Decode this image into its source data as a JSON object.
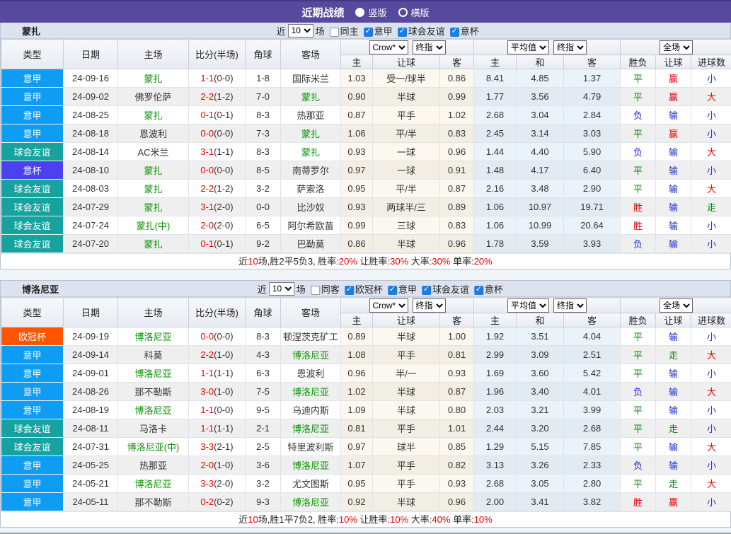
{
  "topbar": {
    "title": "近期战绩",
    "options": [
      {
        "label": "竖版",
        "selected": true
      },
      {
        "label": "横版",
        "selected": false
      }
    ]
  },
  "table_header": {
    "main_columns": [
      "类型",
      "日期",
      "主场",
      "比分(半场)",
      "角球",
      "客场"
    ],
    "group1": {
      "selects": [
        "Crow*",
        "终指"
      ],
      "subs": [
        "主",
        "让球",
        "客"
      ]
    },
    "group2": {
      "selects": [
        "平均值",
        "终指"
      ],
      "subs": [
        "主",
        "和",
        "客"
      ]
    },
    "group3": {
      "selects": [
        "全场"
      ],
      "subs": [
        "胜负",
        "让球",
        "进球数"
      ]
    }
  },
  "type_colors": {
    "意甲": "#0f9cf3",
    "球会友谊": "#16a29e",
    "意杯": "#4b42ee",
    "欧冠杯": "#ff5500"
  },
  "outcome_colors": {
    "red": "#e00000",
    "green": "#088108",
    "blue": "#2230ce"
  },
  "outcome_map": {
    "胜": "red",
    "赢": "red",
    "大": "red",
    "平": "green",
    "走": "green",
    "负": "blue",
    "输": "blue",
    "小": "blue"
  },
  "sections": [
    {
      "team": "蒙扎",
      "filter": {
        "near": "近",
        "count": "10",
        "games": "场",
        "same": "同主",
        "leagues": [
          "意甲",
          "球会友谊",
          "意杯"
        ]
      },
      "rows": [
        {
          "type": "意甲",
          "date": "24-09-16",
          "home": "蒙扎",
          "home_hl": true,
          "ft": "1-1",
          "ht": "(0-0)",
          "corner": "1-8",
          "away": "国际米兰",
          "away_hl": false,
          "crow_home": "1.03",
          "handicap": "受一/球半",
          "crow_away": "0.86",
          "avg_home": "8.41",
          "avg_draw": "4.85",
          "avg_away": "1.37",
          "result": "平",
          "hresult": "赢",
          "goals": "小"
        },
        {
          "type": "意甲",
          "date": "24-09-02",
          "home": "佛罗伦萨",
          "home_hl": false,
          "ft": "2-2",
          "ht": "(1-2)",
          "corner": "7-0",
          "away": "蒙扎",
          "away_hl": true,
          "crow_home": "0.90",
          "handicap": "半球",
          "crow_away": "0.99",
          "avg_home": "1.77",
          "avg_draw": "3.56",
          "avg_away": "4.79",
          "result": "平",
          "hresult": "赢",
          "goals": "大"
        },
        {
          "type": "意甲",
          "date": "24-08-25",
          "home": "蒙扎",
          "home_hl": true,
          "ft": "0-1",
          "ht": "(0-1)",
          "corner": "8-3",
          "away": "热那亚",
          "away_hl": false,
          "crow_home": "0.87",
          "handicap": "平手",
          "crow_away": "1.02",
          "avg_home": "2.68",
          "avg_draw": "3.04",
          "avg_away": "2.84",
          "result": "负",
          "hresult": "输",
          "goals": "小"
        },
        {
          "type": "意甲",
          "date": "24-08-18",
          "home": "恩波利",
          "home_hl": false,
          "ft": "0-0",
          "ht": "(0-0)",
          "corner": "7-3",
          "away": "蒙扎",
          "away_hl": true,
          "crow_home": "1.06",
          "handicap": "平/半",
          "crow_away": "0.83",
          "avg_home": "2.45",
          "avg_draw": "3.14",
          "avg_away": "3.03",
          "result": "平",
          "hresult": "赢",
          "goals": "小"
        },
        {
          "type": "球会友谊",
          "date": "24-08-14",
          "home": "AC米兰",
          "home_hl": false,
          "ft": "3-1",
          "ht": "(1-1)",
          "corner": "8-3",
          "away": "蒙扎",
          "away_hl": true,
          "crow_home": "0.93",
          "handicap": "一球",
          "crow_away": "0.96",
          "avg_home": "1.44",
          "avg_draw": "4.40",
          "avg_away": "5.90",
          "result": "负",
          "hresult": "输",
          "goals": "大"
        },
        {
          "type": "意杯",
          "date": "24-08-10",
          "home": "蒙扎",
          "home_hl": true,
          "ft": "0-0",
          "ht": "(0-0)",
          "corner": "8-5",
          "away": "南蒂罗尔",
          "away_hl": false,
          "crow_home": "0.97",
          "handicap": "一球",
          "crow_away": "0.91",
          "avg_home": "1.48",
          "avg_draw": "4.17",
          "avg_away": "6.40",
          "result": "平",
          "hresult": "输",
          "goals": "小"
        },
        {
          "type": "球会友谊",
          "date": "24-08-03",
          "home": "蒙扎",
          "home_hl": true,
          "ft": "2-2",
          "ht": "(1-2)",
          "corner": "3-2",
          "away": "萨索洛",
          "away_hl": false,
          "crow_home": "0.95",
          "handicap": "平/半",
          "crow_away": "0.87",
          "avg_home": "2.16",
          "avg_draw": "3.48",
          "avg_away": "2.90",
          "result": "平",
          "hresult": "输",
          "goals": "大"
        },
        {
          "type": "球会友谊",
          "date": "24-07-29",
          "home": "蒙扎",
          "home_hl": true,
          "ft": "3-1",
          "ht": "(2-0)",
          "corner": "0-0",
          "away": "比沙奴",
          "away_hl": false,
          "crow_home": "0.93",
          "handicap": "两球半/三",
          "crow_away": "0.89",
          "avg_home": "1.06",
          "avg_draw": "10.97",
          "avg_away": "19.71",
          "result": "胜",
          "hresult": "输",
          "goals": "走"
        },
        {
          "type": "球会友谊",
          "date": "24-07-24",
          "home": "蒙扎(中)",
          "home_hl": true,
          "ft": "2-0",
          "ht": "(2-0)",
          "corner": "6-5",
          "away": "阿尔希欧苗",
          "away_hl": false,
          "crow_home": "0.99",
          "handicap": "三球",
          "crow_away": "0.83",
          "avg_home": "1.06",
          "avg_draw": "10.99",
          "avg_away": "20.64",
          "result": "胜",
          "hresult": "输",
          "goals": "小"
        },
        {
          "type": "球会友谊",
          "date": "24-07-20",
          "home": "蒙扎",
          "home_hl": true,
          "ft": "0-1",
          "ht": "(0-1)",
          "corner": "9-2",
          "away": "巴勒莫",
          "away_hl": false,
          "crow_home": "0.86",
          "handicap": "半球",
          "crow_away": "0.96",
          "avg_home": "1.78",
          "avg_draw": "3.59",
          "avg_away": "3.93",
          "result": "负",
          "hresult": "输",
          "goals": "小"
        }
      ],
      "summary": [
        {
          "t": "近",
          "red": false
        },
        {
          "t": "10",
          "red": true
        },
        {
          "t": "场,胜2平5负3, 胜率:",
          "red": false
        },
        {
          "t": "20%",
          "red": true
        },
        {
          "t": " 让胜率:",
          "red": false
        },
        {
          "t": "30%",
          "red": true
        },
        {
          "t": " 大率:",
          "red": false
        },
        {
          "t": "30%",
          "red": true
        },
        {
          "t": " 单率:",
          "red": false
        },
        {
          "t": "20%",
          "red": true
        }
      ]
    },
    {
      "team": "博洛尼亚",
      "filter": {
        "near": "近",
        "count": "10",
        "games": "场",
        "same": "同客",
        "leagues": [
          "欧冠杯",
          "意甲",
          "球会友谊",
          "意杯"
        ]
      },
      "rows": [
        {
          "type": "欧冠杯",
          "date": "24-09-19",
          "home": "博洛尼亚",
          "home_hl": true,
          "ft": "0-0",
          "ht": "(0-0)",
          "corner": "8-3",
          "away": "顿涅茨克矿工",
          "away_hl": false,
          "crow_home": "0.89",
          "handicap": "半球",
          "crow_away": "1.00",
          "avg_home": "1.92",
          "avg_draw": "3.51",
          "avg_away": "4.04",
          "result": "平",
          "hresult": "输",
          "goals": "小"
        },
        {
          "type": "意甲",
          "date": "24-09-14",
          "home": "科莫",
          "home_hl": false,
          "ft": "2-2",
          "ht": "(1-0)",
          "corner": "4-3",
          "away": "博洛尼亚",
          "away_hl": true,
          "crow_home": "1.08",
          "handicap": "平手",
          "crow_away": "0.81",
          "avg_home": "2.99",
          "avg_draw": "3.09",
          "avg_away": "2.51",
          "result": "平",
          "hresult": "走",
          "goals": "大"
        },
        {
          "type": "意甲",
          "date": "24-09-01",
          "home": "博洛尼亚",
          "home_hl": true,
          "ft": "1-1",
          "ht": "(1-1)",
          "corner": "6-3",
          "away": "恩波利",
          "away_hl": false,
          "crow_home": "0.96",
          "handicap": "半/一",
          "crow_away": "0.93",
          "avg_home": "1.69",
          "avg_draw": "3.60",
          "avg_away": "5.42",
          "result": "平",
          "hresult": "输",
          "goals": "小"
        },
        {
          "type": "意甲",
          "date": "24-08-26",
          "home": "那不勒斯",
          "home_hl": false,
          "ft": "3-0",
          "ht": "(1-0)",
          "corner": "7-5",
          "away": "博洛尼亚",
          "away_hl": true,
          "crow_home": "1.02",
          "handicap": "半球",
          "crow_away": "0.87",
          "avg_home": "1.96",
          "avg_draw": "3.40",
          "avg_away": "4.01",
          "result": "负",
          "hresult": "输",
          "goals": "大"
        },
        {
          "type": "意甲",
          "date": "24-08-19",
          "home": "博洛尼亚",
          "home_hl": true,
          "ft": "1-1",
          "ht": "(0-0)",
          "corner": "9-5",
          "away": "乌迪内斯",
          "away_hl": false,
          "crow_home": "1.09",
          "handicap": "半球",
          "crow_away": "0.80",
          "avg_home": "2.03",
          "avg_draw": "3.21",
          "avg_away": "3.99",
          "result": "平",
          "hresult": "输",
          "goals": "小"
        },
        {
          "type": "球会友谊",
          "date": "24-08-11",
          "home": "马洛卡",
          "home_hl": false,
          "ft": "1-1",
          "ht": "(1-1)",
          "corner": "2-1",
          "away": "博洛尼亚",
          "away_hl": true,
          "crow_home": "0.81",
          "handicap": "平手",
          "crow_away": "1.01",
          "avg_home": "2.44",
          "avg_draw": "3.20",
          "avg_away": "2.68",
          "result": "平",
          "hresult": "走",
          "goals": "小"
        },
        {
          "type": "球会友谊",
          "date": "24-07-31",
          "home": "博洛尼亚(中)",
          "home_hl": true,
          "ft": "3-3",
          "ht": "(2-1)",
          "corner": "2-5",
          "away": "特里波利斯",
          "away_hl": false,
          "crow_home": "0.97",
          "handicap": "球半",
          "crow_away": "0.85",
          "avg_home": "1.29",
          "avg_draw": "5.15",
          "avg_away": "7.85",
          "result": "平",
          "hresult": "输",
          "goals": "大"
        },
        {
          "type": "意甲",
          "date": "24-05-25",
          "home": "热那亚",
          "home_hl": false,
          "ft": "2-0",
          "ht": "(1-0)",
          "corner": "3-6",
          "away": "博洛尼亚",
          "away_hl": true,
          "crow_home": "1.07",
          "handicap": "平手",
          "crow_away": "0.82",
          "avg_home": "3.13",
          "avg_draw": "3.26",
          "avg_away": "2.33",
          "result": "负",
          "hresult": "输",
          "goals": "小"
        },
        {
          "type": "意甲",
          "date": "24-05-21",
          "home": "博洛尼亚",
          "home_hl": true,
          "ft": "3-3",
          "ht": "(2-0)",
          "corner": "3-2",
          "away": "尤文图斯",
          "away_hl": false,
          "crow_home": "0.95",
          "handicap": "平手",
          "crow_away": "0.93",
          "avg_home": "2.68",
          "avg_draw": "3.05",
          "avg_away": "2.80",
          "result": "平",
          "hresult": "走",
          "goals": "大"
        },
        {
          "type": "意甲",
          "date": "24-05-11",
          "home": "那不勒斯",
          "home_hl": false,
          "ft": "0-2",
          "ht": "(0-2)",
          "corner": "9-3",
          "away": "博洛尼亚",
          "away_hl": true,
          "crow_home": "0.92",
          "handicap": "半球",
          "crow_away": "0.96",
          "avg_home": "2.00",
          "avg_draw": "3.41",
          "avg_away": "3.82",
          "result": "胜",
          "hresult": "赢",
          "goals": "小"
        }
      ],
      "summary": [
        {
          "t": "近",
          "red": false
        },
        {
          "t": "10",
          "red": true
        },
        {
          "t": "场,胜1平7负2, 胜率:",
          "red": false
        },
        {
          "t": "10%",
          "red": true
        },
        {
          "t": " 让胜率:",
          "red": false
        },
        {
          "t": "10%",
          "red": true
        },
        {
          "t": " 大率:",
          "red": false
        },
        {
          "t": "40%",
          "red": true
        },
        {
          "t": " 单率:",
          "red": false
        },
        {
          "t": "10%",
          "red": true
        }
      ]
    }
  ]
}
